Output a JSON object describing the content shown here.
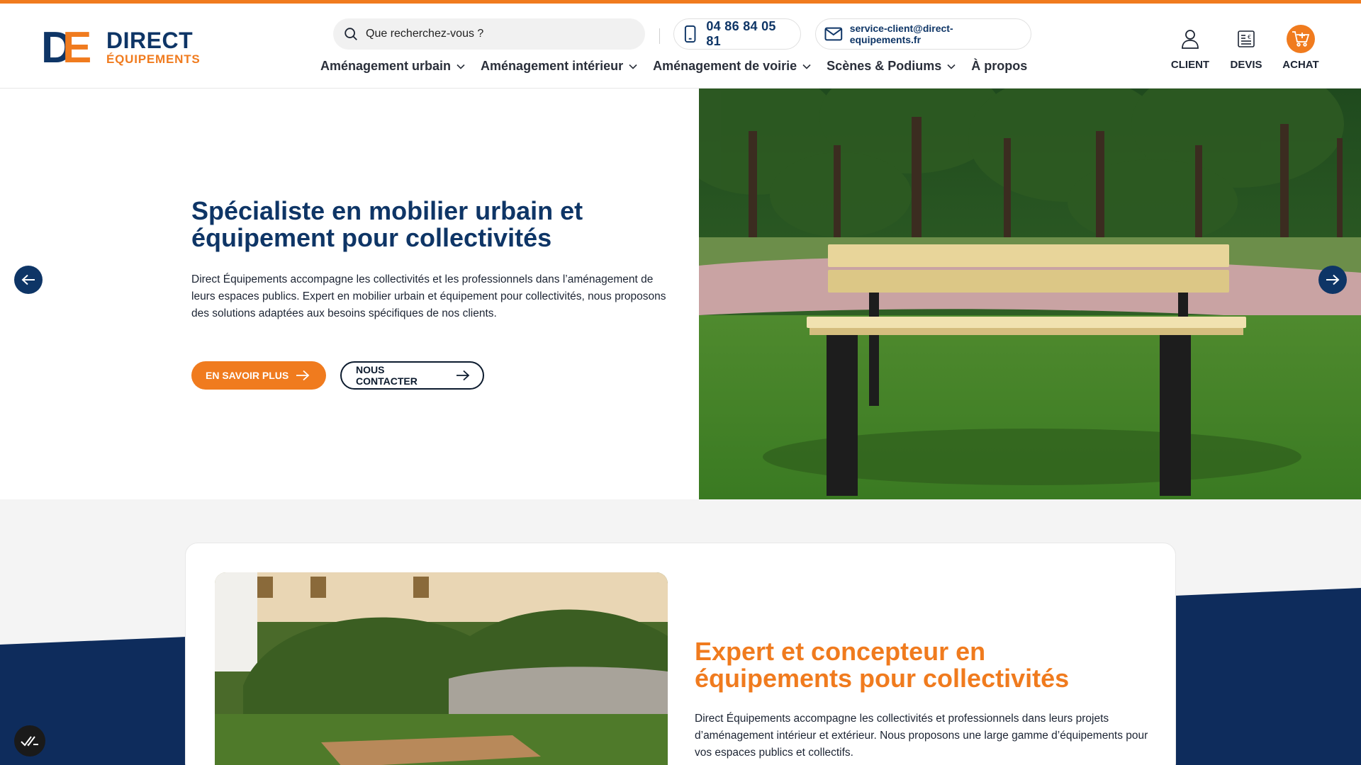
{
  "brand": {
    "logo_d": "D",
    "logo_e": "E",
    "name_line1": "DIRECT",
    "name_line2": "ÉQUIPEMENTS",
    "primary_color": "#0e3566",
    "accent_color": "#f07b1e"
  },
  "header": {
    "search_placeholder": "Que recherchez-vous ?",
    "phone": "04 86 84 05 81",
    "email": "service-client@direct-equipements.fr",
    "icons": {
      "search": "search-icon",
      "phone": "phone-icon",
      "email": "mail-icon"
    }
  },
  "nav": {
    "items": [
      {
        "label": "Aménagement urbain",
        "has_dropdown": true
      },
      {
        "label": "Aménagement intérieur",
        "has_dropdown": true
      },
      {
        "label": "Aménagement de voirie",
        "has_dropdown": true
      },
      {
        "label": "Scènes & Podiums",
        "has_dropdown": true
      },
      {
        "label": "À propos",
        "has_dropdown": false
      }
    ]
  },
  "account": {
    "client": {
      "label": "CLIENT",
      "icon": "user-icon"
    },
    "devis": {
      "label": "DEVIS",
      "icon": "quote-icon"
    },
    "achat": {
      "label": "ACHAT",
      "icon": "cart-icon"
    }
  },
  "hero": {
    "title": "Spécialiste en mobilier urbain et équipement pour collectivités",
    "description": "Direct Équipements accompagne les collectivités et les professionnels dans l’aménagement de leurs espaces publics. Expert en mobilier urbain et équipement pour collectivités, nous proposons des solutions adaptées aux besoins spécifiques de nos clients.",
    "btn_primary": "EN SAVOIR PLUS",
    "btn_secondary": "NOUS CONTACTER",
    "image": "park-bench-photo"
  },
  "section2": {
    "title": "Expert et concepteur en équipements pour collectivités",
    "description": "Direct Équipements accompagne les collectivités et professionnels dans leurs projets d’aménagement intérieur et extérieur. Nous proposons une large gamme d’équipements pour vos espaces publics et collectifs.",
    "image": "picnic-table-photo"
  }
}
